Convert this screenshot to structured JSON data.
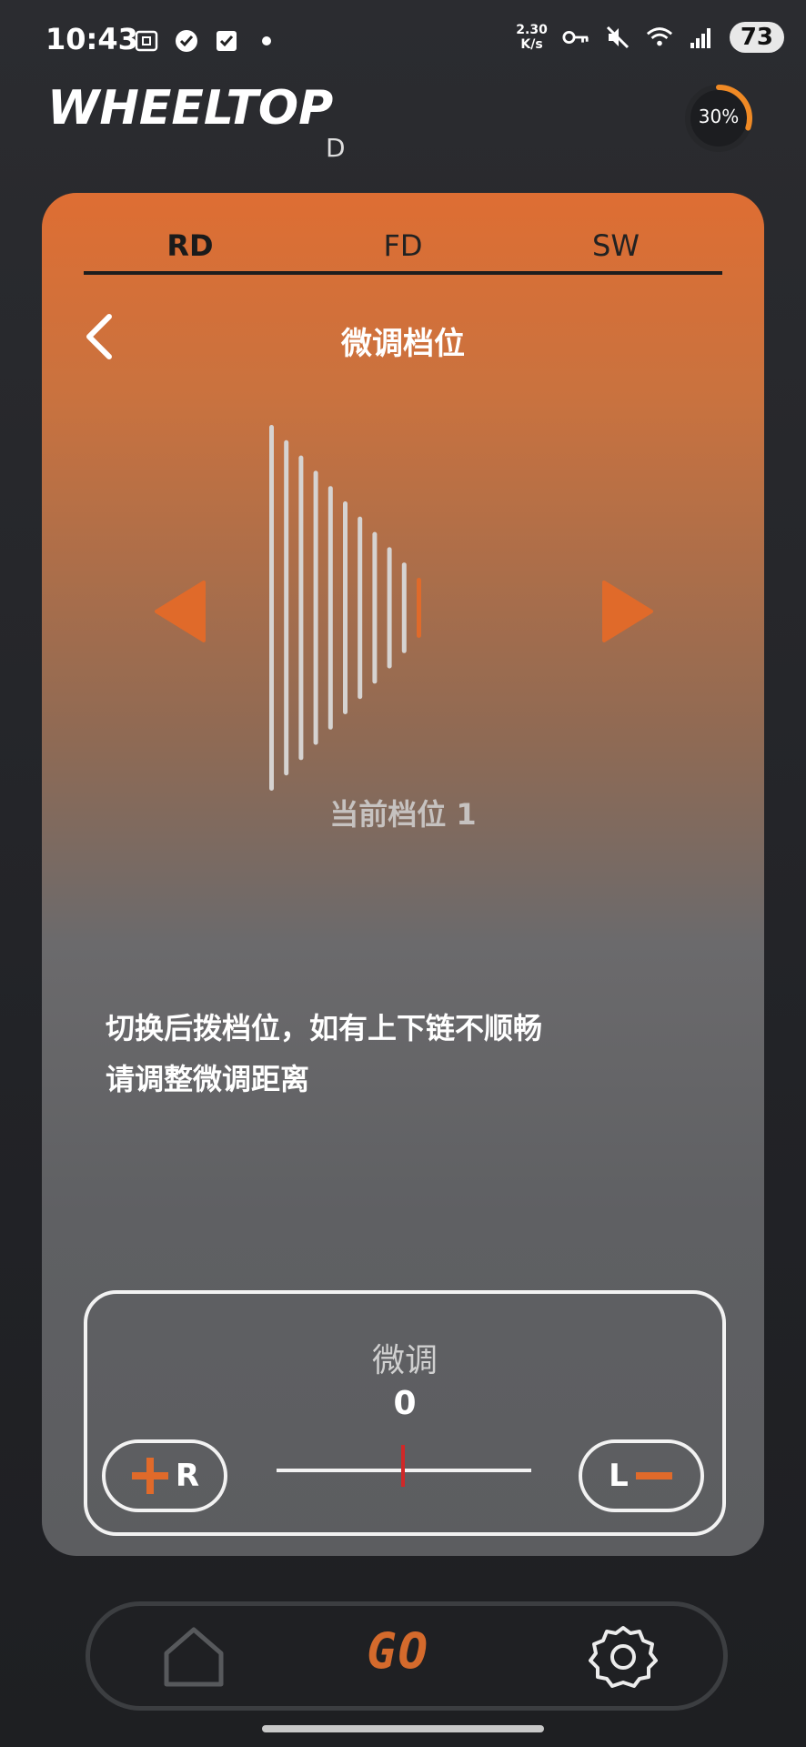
{
  "status_bar": {
    "time": "10:43",
    "net_speed_value": "2.30",
    "net_speed_unit": "K/s",
    "battery": "73"
  },
  "header": {
    "logo_text": "WHEELTOP",
    "device_letter": "D",
    "progress_percent": 30,
    "progress_label": "30%"
  },
  "tabs": [
    {
      "label": "RD",
      "active": true
    },
    {
      "label": "FD",
      "active": false
    },
    {
      "label": "SW",
      "active": false
    }
  ],
  "page": {
    "title": "微调档位",
    "current_gear_text": "当前档位 1",
    "hint_line1": "切换后拨档位，如有上下链不顺畅",
    "hint_line2": "请调整微调距离"
  },
  "gears": {
    "count": 11,
    "current": 1
  },
  "fine_tune": {
    "label": "微调",
    "value": "0",
    "plus_button_letter": "R",
    "minus_button_letter": "L"
  },
  "nav": {
    "go_label": "GO"
  },
  "colors": {
    "accent": "#e06a2a",
    "card_top": "#de6e33",
    "card_bottom": "#5c5d60",
    "marker": "#d02828"
  }
}
